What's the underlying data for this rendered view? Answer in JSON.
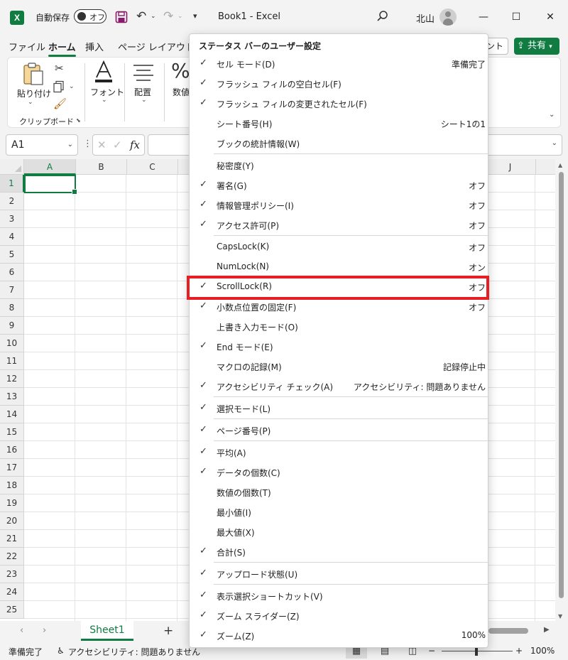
{
  "titlebar": {
    "app_icon": "excel-logo",
    "autosave_label": "自動保存",
    "autosave_state": "オフ",
    "doc_title": "Book1  -  Excel",
    "user_name": "北山",
    "minimize": "—",
    "maximize": "☐",
    "close": "✕"
  },
  "tabs": [
    {
      "label": "ファイル"
    },
    {
      "label": "ホーム"
    },
    {
      "label": "挿入"
    },
    {
      "label": "ページ レイアウト"
    }
  ],
  "comment_label": "ント",
  "share_label": "共有",
  "ribbon": {
    "paste_label": "貼り付け",
    "clipboard_label": "クリップボード",
    "font_label": "フォント",
    "align_label": "配置",
    "number_label": "数値"
  },
  "formula_bar": {
    "namebox": "A1",
    "fx": "fx",
    "cancel": "✕",
    "enter": "✓"
  },
  "grid": {
    "columns": [
      "A",
      "B",
      "C",
      "J"
    ],
    "rows": [
      "1",
      "2",
      "3",
      "4",
      "5",
      "6",
      "7",
      "8",
      "9",
      "10",
      "11",
      "12",
      "13",
      "14",
      "15",
      "16",
      "17",
      "18",
      "19",
      "20",
      "21",
      "22",
      "23",
      "24",
      "25"
    ],
    "selected_cell": "A1"
  },
  "sheet_tab": "Sheet1",
  "add_sheet": "+",
  "statusbar": {
    "ready": "準備完了",
    "accessibility": "アクセシビリティ: 問題ありません",
    "zoom_minus": "−",
    "zoom_plus": "+",
    "zoom": "100%"
  },
  "menu": {
    "title": "ステータス バーのユーザー設定",
    "items": [
      {
        "label": "セル モード(D)",
        "value": "準備完了",
        "checked": true
      },
      {
        "label": "フラッシュ フィルの空白セル(F)",
        "value": "",
        "checked": true
      },
      {
        "label": "フラッシュ フィルの変更されたセル(F)",
        "value": "",
        "checked": true
      },
      {
        "label": "シート番号(H)",
        "value": "シート1の1",
        "checked": false
      },
      {
        "label": "ブックの統計情報(W)",
        "value": "",
        "checked": false
      },
      {
        "label": "秘密度(Y)",
        "value": "",
        "checked": false
      },
      {
        "label": "署名(G)",
        "value": "オフ",
        "checked": true
      },
      {
        "label": "情報管理ポリシー(I)",
        "value": "オフ",
        "checked": true
      },
      {
        "label": "アクセス許可(P)",
        "value": "オフ",
        "checked": true
      },
      {
        "label": "CapsLock(K)",
        "value": "オフ",
        "checked": false
      },
      {
        "label": "NumLock(N)",
        "value": "オン",
        "checked": false
      },
      {
        "label": "ScrollLock(R)",
        "value": "オフ",
        "checked": true
      },
      {
        "label": "小数点位置の固定(F)",
        "value": "オフ",
        "checked": true
      },
      {
        "label": "上書き入力モード(O)",
        "value": "",
        "checked": false
      },
      {
        "label": "End モード(E)",
        "value": "",
        "checked": true
      },
      {
        "label": "マクロの記録(M)",
        "value": "記録停止中",
        "checked": false
      },
      {
        "label": "アクセシビリティ チェック(A)",
        "value": "アクセシビリティ: 問題ありません",
        "checked": true
      },
      {
        "label": "選択モード(L)",
        "value": "",
        "checked": true
      },
      {
        "label": "ページ番号(P)",
        "value": "",
        "checked": true
      },
      {
        "label": "平均(A)",
        "value": "",
        "checked": true
      },
      {
        "label": "データの個数(C)",
        "value": "",
        "checked": true
      },
      {
        "label": "数値の個数(T)",
        "value": "",
        "checked": false
      },
      {
        "label": "最小値(I)",
        "value": "",
        "checked": false
      },
      {
        "label": "最大値(X)",
        "value": "",
        "checked": false
      },
      {
        "label": "合計(S)",
        "value": "",
        "checked": true
      },
      {
        "label": "アップロード状態(U)",
        "value": "",
        "checked": true
      },
      {
        "label": "表示選択ショートカット(V)",
        "value": "",
        "checked": true
      },
      {
        "label": "ズーム スライダー(Z)",
        "value": "",
        "checked": true
      },
      {
        "label": "ズーム(Z)",
        "value": "100%",
        "checked": true
      }
    ]
  },
  "colors": {
    "accent": "#107c41",
    "highlight": "#e81e25"
  }
}
